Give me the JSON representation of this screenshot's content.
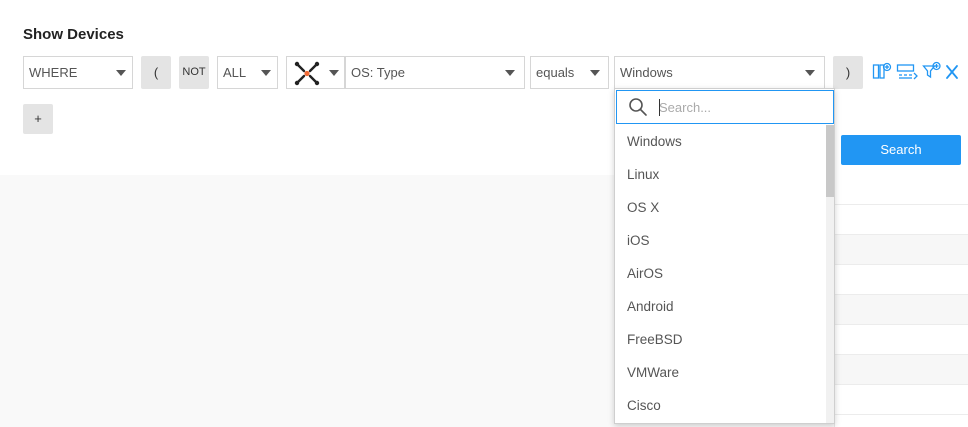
{
  "title": "Show Devices",
  "query": {
    "where_select": "WHERE",
    "open_paren": "(",
    "not_button": "NOT",
    "all_select": "ALL",
    "field_select": "OS: Type",
    "operator_select": "equals",
    "value_select": "Windows",
    "close_paren": ")"
  },
  "add_button": "+",
  "search_button": "Search",
  "dropdown": {
    "search_placeholder": "Search...",
    "options": [
      "Windows",
      "Linux",
      "OS X",
      "iOS",
      "AirOS",
      "Android",
      "FreeBSD",
      "VMWare",
      "Cisco"
    ]
  },
  "icons": {
    "adapter": "adapters-network-icon",
    "actions": [
      "column-filter-icon",
      "nested-expression-icon",
      "add-filter-icon",
      "remove-condition-icon"
    ]
  },
  "colors": {
    "accent": "#2196f3",
    "adapter_orange": "#f06a35",
    "adapter_dark": "#222222"
  }
}
